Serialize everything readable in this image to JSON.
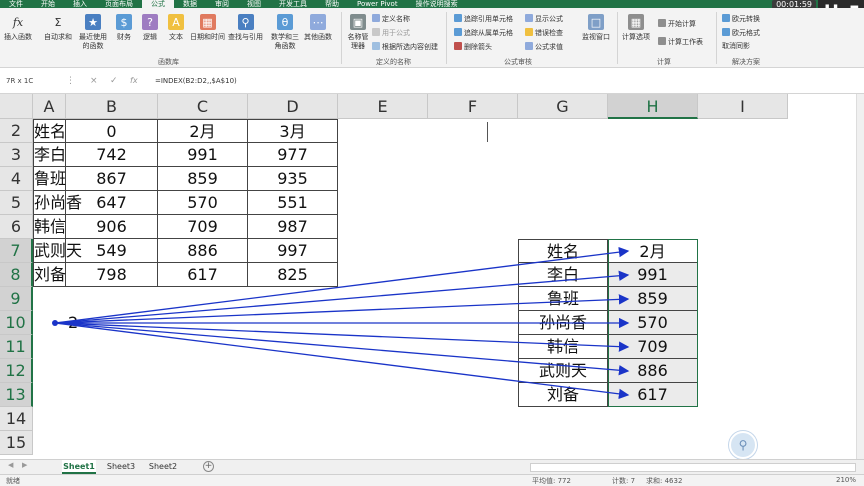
{
  "ribbon_tabs": [
    "文件",
    "开始",
    "插入",
    "页面布局",
    "公式",
    "数据",
    "审阅",
    "视图",
    "开发工具",
    "帮助",
    "Power Pivot",
    "操作说明搜索"
  ],
  "active_tab_index": 4,
  "timer": "00:01:59",
  "ribbon": {
    "insert_function": "插入函数",
    "autosum": "自动求和",
    "recent": "最近使用的函数",
    "finance": "财务",
    "logic": "逻辑",
    "text": "文本",
    "datetime": "日期和时间",
    "lookup": "查找与引用",
    "math": "数学和三角函数",
    "other": "其他函数",
    "group_library": "函数库",
    "name_manager": "名称管理器",
    "define_name": "定义名称",
    "use_in_formula": "用于公式",
    "create_from_selection": "根据所选内容创建",
    "group_names": "定义的名称",
    "trace_precedents": "追踪引用单元格",
    "trace_dependents": "追踪从属单元格",
    "remove_arrows": "删除箭头",
    "show_formulas": "显示公式",
    "error_checking": "错误检查",
    "evaluate_formula": "公式求值",
    "group_audit": "公式审核",
    "watch_window": "监视窗口",
    "calc_options": "计算选项",
    "calc_now": "开始计算",
    "calc_sheet": "计算工作表",
    "group_calc": "计算",
    "solution1": "欧元转换",
    "solution2": "欧元格式",
    "solution3": "取消同影",
    "group_solutions": "解决方案"
  },
  "formula_bar": {
    "name_box": "7R x 1C",
    "formula": "=INDEX(B2:D2,,$A$10)"
  },
  "columns": [
    "A",
    "B",
    "C",
    "D",
    "E",
    "F",
    "G",
    "H",
    "I"
  ],
  "rows": [
    "2",
    "3",
    "4",
    "5",
    "6",
    "7",
    "8",
    "9",
    "10",
    "11",
    "12",
    "13",
    "14",
    "15"
  ],
  "table1": {
    "header": [
      "姓名",
      "0",
      "2月",
      "3月"
    ],
    "rows": [
      [
        "李白",
        "742",
        "991",
        "977"
      ],
      [
        "鲁班",
        "867",
        "859",
        "935"
      ],
      [
        "孙尚香",
        "647",
        "570",
        "551"
      ],
      [
        "韩信",
        "906",
        "709",
        "987"
      ],
      [
        "武则天",
        "549",
        "886",
        "997"
      ],
      [
        "刘备",
        "798",
        "617",
        "825"
      ]
    ]
  },
  "b10_value": "2",
  "table2": {
    "header": [
      "姓名",
      "2月"
    ],
    "rows": [
      [
        "李白",
        "991"
      ],
      [
        "鲁班",
        "859"
      ],
      [
        "孙尚香",
        "570"
      ],
      [
        "韩信",
        "709"
      ],
      [
        "武则天",
        "886"
      ],
      [
        "刘备",
        "617"
      ]
    ]
  },
  "sheets": [
    "Sheet1",
    "Sheet3",
    "Sheet2"
  ],
  "active_sheet_index": 0,
  "status": {
    "mode": "就绪",
    "average": "平均值: 772",
    "count": "计数: 7",
    "sum": "求和: 4632",
    "zoom": "210%"
  },
  "colors": {
    "accent": "#217346",
    "arrow": "#1a34c8"
  }
}
